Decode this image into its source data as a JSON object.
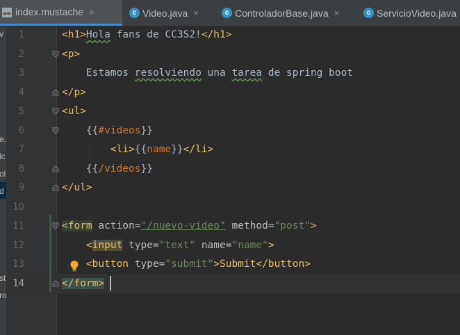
{
  "tabs": [
    {
      "label": "index.mustache",
      "active": true,
      "icon": "mustache-file-icon"
    },
    {
      "label": "Video.java",
      "active": false,
      "icon": "java-class-icon"
    },
    {
      "label": "ControladorBase.java",
      "active": false,
      "icon": "java-class-icon"
    },
    {
      "label": "ServicioVideo.java",
      "active": false,
      "icon": "java-class-icon"
    }
  ],
  "tab_close_glyph": "×",
  "class_badge": "c",
  "left_panel_fragments": [
    "v",
    "e.c",
    "lc",
    "ol",
    "d",
    "st",
    "ro"
  ],
  "line_numbers": [
    "1",
    "2",
    "3",
    "4",
    "5",
    "6",
    "7",
    "8",
    "9",
    "10",
    "11",
    "12",
    "13",
    "14"
  ],
  "current_line": "14",
  "code_lines": [
    [
      "<h1>",
      "Hola",
      " fans de CC3S2!",
      "</h1>"
    ],
    [
      "<p>"
    ],
    [
      "    Estamos ",
      "resolviendo",
      " una ",
      "tarea",
      " de spring boot"
    ],
    [
      "</p>"
    ],
    [
      "<ul>"
    ],
    [
      "    {{",
      "#videos",
      "}}"
    ],
    [
      "        ",
      "<li>",
      "{{",
      "name",
      "}}",
      "</li>"
    ],
    [
      "    {{",
      "/videos",
      "}}"
    ],
    [
      "</ul>"
    ],
    [
      ""
    ],
    [
      "<form",
      " action=",
      "\"/nuevo-video\"",
      " method=",
      "\"post\"",
      ">"
    ],
    [
      "    <",
      "input",
      " type=",
      "\"text\"",
      " name=",
      "\"name\"",
      ">"
    ],
    [
      "    <button",
      " type=",
      "\"submit\"",
      ">Submit",
      "</button>"
    ],
    [
      "</form>"
    ]
  ],
  "colors": {
    "editor_bg": "#2b2b2b",
    "gutter_bg": "#313335",
    "tag": "#e8bf6a",
    "attr": "#bababa",
    "string": "#6a8759",
    "text": "#a9b7c6",
    "mustache_var": "#cc7832",
    "active_tab_underline": "#4a88c7",
    "intention_bulb": "#f0a732"
  },
  "gutter_icons": [
    "fold-icon",
    "intention-bulb-icon"
  ]
}
